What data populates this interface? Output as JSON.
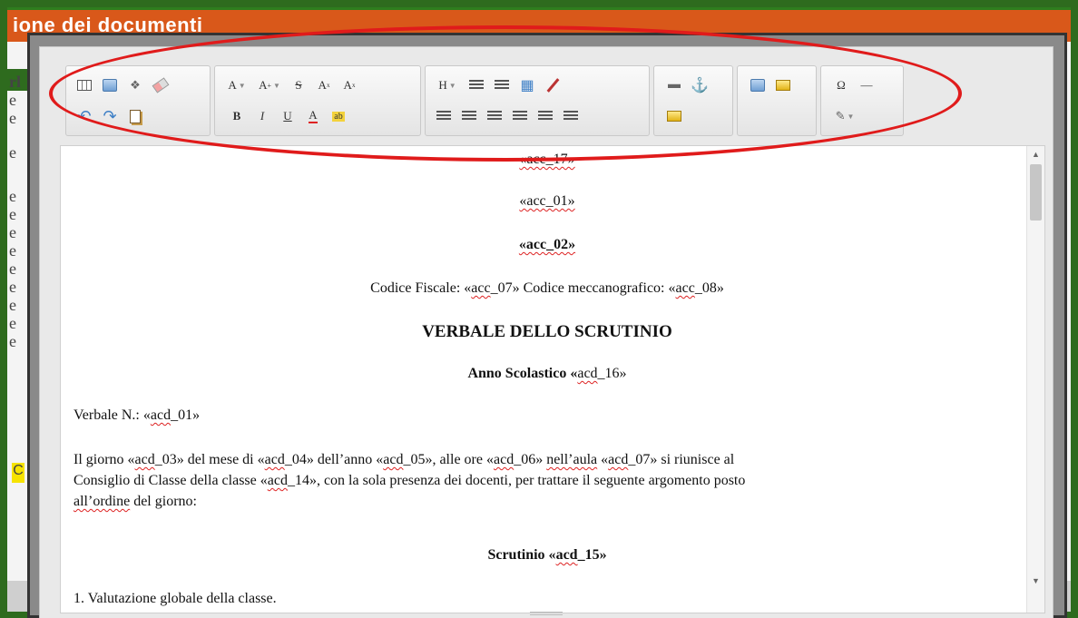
{
  "background_app": {
    "title_fragment": "ione dei documenti",
    "left_letters": [
      "rl",
      "e",
      "e",
      "e",
      "e",
      "e",
      "e",
      "e",
      "e",
      "e",
      "e",
      "e",
      "e"
    ],
    "yellow_letter": "C",
    "colors": {
      "header": "#d9581a",
      "frame": "#2e6b1e"
    }
  },
  "toolbar": {
    "group1": [
      "table-icon",
      "image-icon",
      "find-icon",
      "eraser-icon",
      "undo-icon",
      "redo-icon",
      "paste-icon"
    ],
    "font_a_label": "A",
    "font_size_label": "A",
    "font_size_sup": "+",
    "strike_label": "S",
    "superscript_label": "A",
    "subscript_label": "A",
    "bold_label": "B",
    "italic_label": "I",
    "underline_label": "U",
    "font_color_label": "A",
    "highlight_label": "ab",
    "heading_label": "H",
    "special_char_label": "Ω",
    "hr_label": "—",
    "highlight_color": "#e01b1b"
  },
  "document": {
    "line0": "«acc_17»",
    "line1": "«acc_01»",
    "line2": "«acc_02»",
    "codice_prefix": "Codice Fiscale: «",
    "codice_1": "acc",
    "codice_mid": "_07» Codice meccanografico: «",
    "codice_2": "acc",
    "codice_suffix": "_08»",
    "title": "VERBALE DELLO SCRUTINIO",
    "anno_prefix": "Anno Scolastico «",
    "anno_var": "acd",
    "anno_suffix": "_16»",
    "verbale_prefix": "Verbale N.: «",
    "verbale_var": "acd",
    "verbale_suffix": "_01»",
    "para_a1": "Il giorno «",
    "para_v1": "acd",
    "para_a2": "_03» del mese di «",
    "para_v2": "acd",
    "para_a3": "_04» dell’anno «",
    "para_v3": "acd",
    "para_a4": "_05», alle ore «",
    "para_v4": "acd",
    "para_a5": "_06» ",
    "para_v5": "nell’aula",
    "para_a6": " «",
    "para_v6": "acd",
    "para_a7": "_07» si riunisce al",
    "para_b1": "Consiglio di Classe della classe «",
    "para_v7": "acd",
    "para_b2": "_14», con la sola presenza dei docenti, per trattare il seguente argomento posto",
    "para_v8": "all’ordine",
    "para_c1": " del giorno:",
    "scrutinio_prefix": "Scrutinio «",
    "scrutinio_var": "acd",
    "scrutinio_suffix": "_15»",
    "item1": "1. Valutazione globale della classe."
  }
}
